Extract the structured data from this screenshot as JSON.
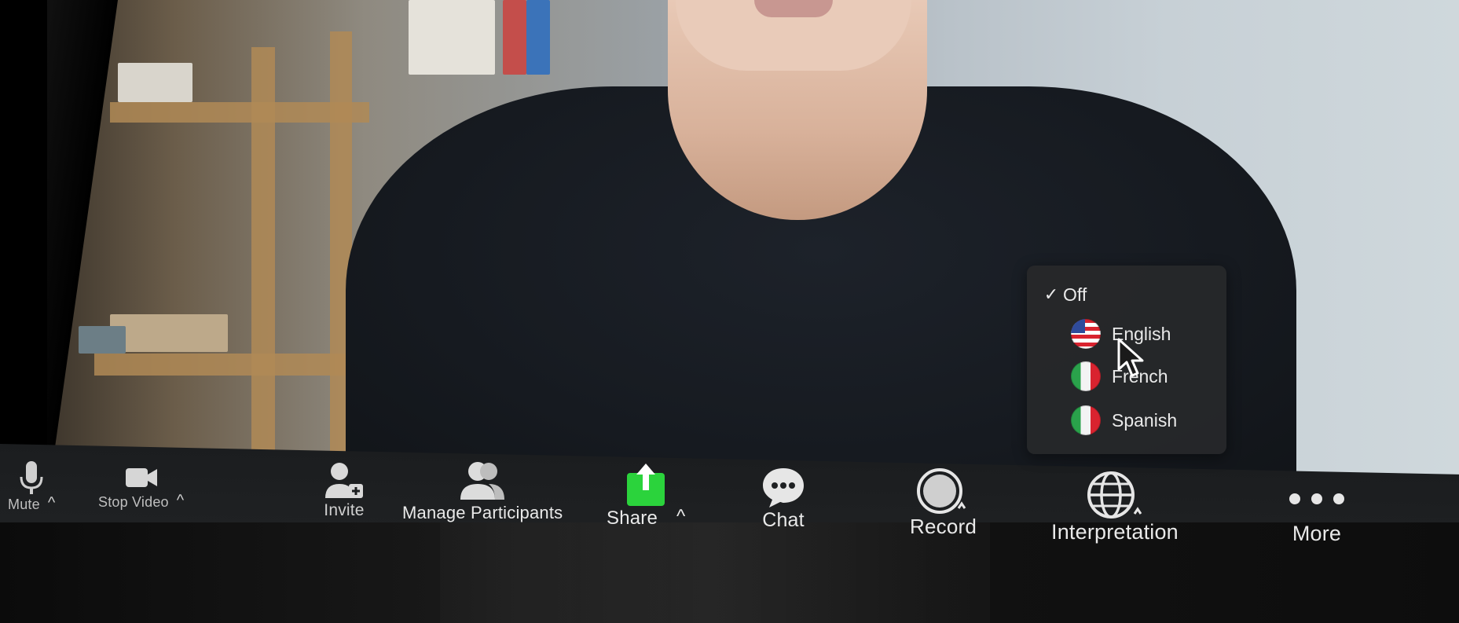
{
  "toolbar": {
    "mute_label": "Mute",
    "stop_video_label": "Stop Video",
    "invite_label": "Invite",
    "manage_participants_label": "Manage Participants",
    "share_label": "Share",
    "chat_label": "Chat",
    "record_label": "Record",
    "interpretation_label": "Interpretation",
    "more_label": "More",
    "caret": "^"
  },
  "interpretation_menu": {
    "items": [
      {
        "label": "Off",
        "checked": true,
        "flag": null
      },
      {
        "label": "English",
        "checked": false,
        "flag": "us-flag-icon"
      },
      {
        "label": "French",
        "checked": false,
        "flag": "it-flag-icon"
      },
      {
        "label": "Spanish",
        "checked": false,
        "flag": "it-flag-icon"
      }
    ]
  },
  "colors": {
    "share_green": "#2bd33c",
    "toolbar_bg": "#1f2123",
    "menu_bg": "#26282a",
    "icon_light": "#e6e6e6"
  }
}
